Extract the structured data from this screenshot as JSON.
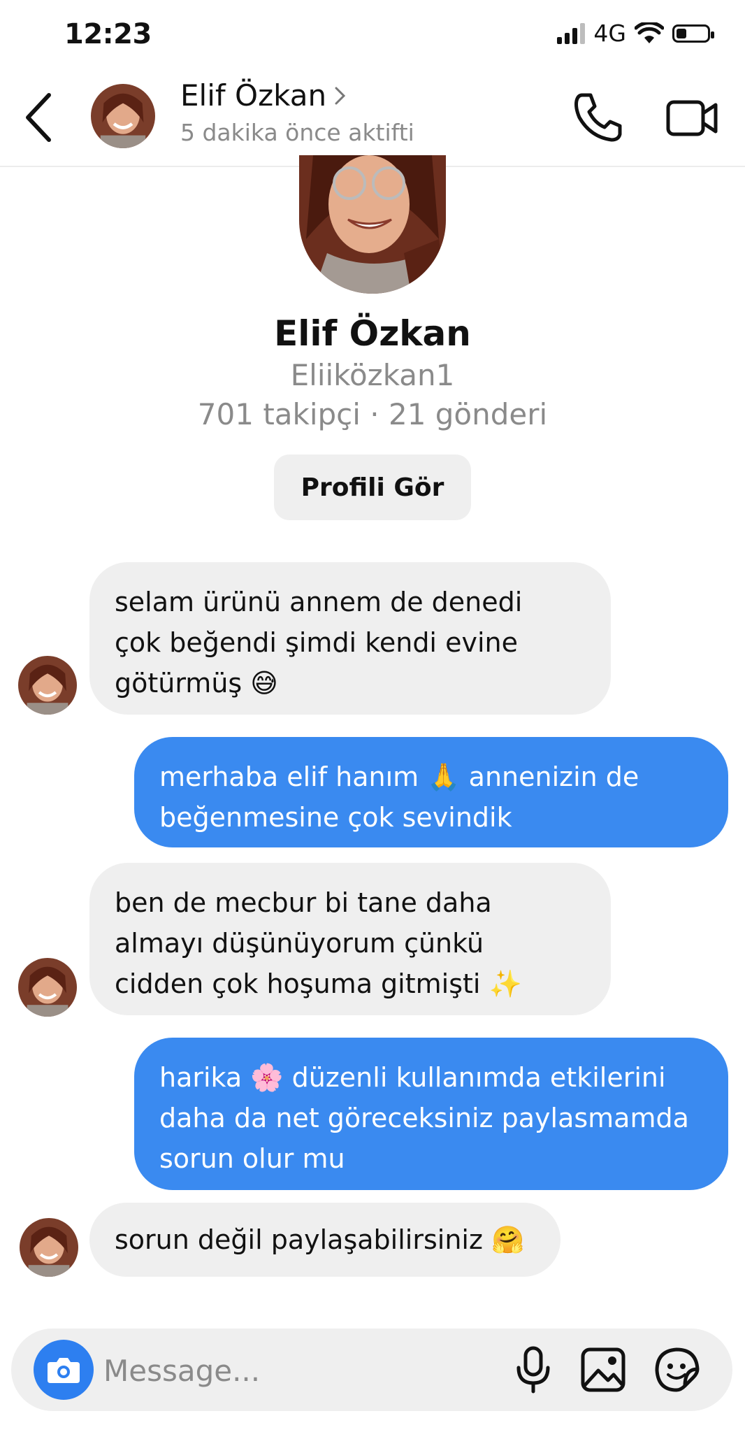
{
  "status_bar": {
    "time": "12:23",
    "network": "4G"
  },
  "header": {
    "name": "Elif Özkan",
    "status": "5 dakika önce aktifti"
  },
  "profile": {
    "name": "Elif Özkan",
    "username": "Eliiközkan1",
    "stats": "701 takipçi · 21 gönderi",
    "view_button": "Profili Gör"
  },
  "messages": [
    {
      "from": "them",
      "lines": [
        "selam ürünü annem de denedi",
        "çok beğendi şimdi kendi evine",
        "götürmüş 😅"
      ]
    },
    {
      "from": "me",
      "lines": [
        "merhaba elif hanım 🙏 annenizin de",
        "beğenmesine çok sevindik"
      ]
    },
    {
      "from": "them",
      "lines": [
        "ben de mecbur bi tane daha",
        "almayı düşünüyorum çünkü",
        "cidden çok hoşuma gitmişti ✨"
      ]
    },
    {
      "from": "me",
      "lines": [
        "harika 🌸 düzenli kullanımda etkilerini",
        "daha da net göreceksiniz paylasmamda",
        "sorun olur mu"
      ]
    },
    {
      "from": "them",
      "lines": [
        "sorun değil paylaşabilirsiniz 🤗"
      ]
    }
  ],
  "composer": {
    "placeholder": "Message..."
  },
  "colors": {
    "accent": "#3a8af0",
    "incoming": "#efefef",
    "camera": "#2d7ff0"
  }
}
